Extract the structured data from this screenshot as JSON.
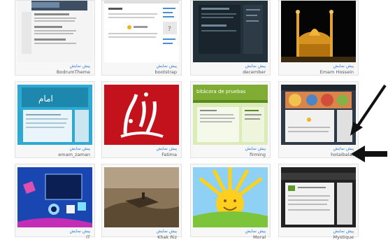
{
  "preview_label": "پیش نمایش",
  "themes": [
    {
      "name": "BodrumTheme"
    },
    {
      "name": "bootstrap"
    },
    {
      "name": "december"
    },
    {
      "name": "Emam Hossein"
    },
    {
      "name": "emam_zaman"
    },
    {
      "name": "Fatima"
    },
    {
      "name": "firming",
      "thumb_title": "bitácora de pruebas"
    },
    {
      "name": "hotaibalat"
    },
    {
      "name": "IT"
    },
    {
      "name": "Khak Riz"
    },
    {
      "name": "Moral"
    },
    {
      "name": "Mystique"
    }
  ],
  "colors": {
    "link": "#2a7bd3",
    "arrow": "#111111"
  }
}
